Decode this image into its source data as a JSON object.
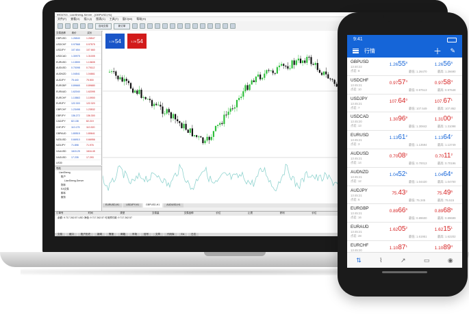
{
  "desktop": {
    "window_title": "9903703 - LianSheng-Server - [GBPUSD,H1]",
    "menu": [
      "文件(F)",
      "查看(V)",
      "插入(I)",
      "图表(C)",
      "工具(T)",
      "窗口(W)",
      "帮助(H)"
    ],
    "toolbar": {
      "algo_label": "自动交易",
      "new_order_label": "新订单"
    },
    "market_watch": {
      "title": "市场报价: 13:48:30",
      "headers": [
        "交易品种",
        "卖价",
        "买价"
      ],
      "rows": [
        {
          "sym": "GBPUSD",
          "bid": "1.26540",
          "ask": "1.26547"
        },
        {
          "sym": "USDCHF",
          "bid": "0.97568",
          "ask": "0.97575"
        },
        {
          "sym": "USDJPY",
          "bid": "107.654",
          "ask": "107.660"
        },
        {
          "sym": "USDCAD",
          "bid": "1.30975",
          "ask": "1.31005"
        },
        {
          "sym": "EURUSD",
          "bid": "1.13599",
          "ask": "1.13605"
        },
        {
          "sym": "AUDUSD",
          "bid": "0.70098",
          "ask": "0.70112"
        },
        {
          "sym": "AUDNZD",
          "bid": "1.04541",
          "ask": "1.04661"
        },
        {
          "sym": "AUDJPY",
          "bid": "75.440",
          "ask": "75.500"
        },
        {
          "sym": "EURGBP",
          "bid": "0.89665",
          "ask": "0.89680"
        },
        {
          "sym": "EURAUD",
          "bid": "1.62040",
          "ask": "1.62095"
        },
        {
          "sym": "EURCHF",
          "bid": "1.10863",
          "ask": "1.10900"
        },
        {
          "sym": "EURJPY",
          "bid": "122.303",
          "ask": "122.320"
        },
        {
          "sym": "GBPCHF",
          "bid": "1.23498",
          "ask": "1.23532"
        },
        {
          "sym": "GBPJPY",
          "bid": "136.272",
          "ask": "136.300"
        },
        {
          "sym": "CADJPY",
          "bid": "82.138",
          "ask": "82.219"
        },
        {
          "sym": "CHFJPY",
          "bid": "110.175",
          "ask": "110.320"
        },
        {
          "sym": "GBPAUD",
          "bid": "1.80515",
          "ask": "1.80641"
        },
        {
          "sym": "NZDUSD",
          "bid": "0.66910",
          "ask": "0.66956"
        },
        {
          "sym": "NZDJPY",
          "bid": "71.898",
          "ask": "71.976"
        },
        {
          "sym": "XAUUSD",
          "bid": "1615.25",
          "ask": "1616.45"
        },
        {
          "sym": "XAGUSD",
          "bid": "17.235",
          "ask": "17.293"
        },
        {
          "sym": "US30",
          "bid": "",
          "ask": ""
        },
        {
          "sym": "UK100",
          "bid": "",
          "ask": ""
        },
        {
          "sym": "NK225",
          "bid": "",
          "ask": ""
        },
        {
          "sym": "FRA40",
          "bid": "",
          "ask": ""
        }
      ]
    },
    "navigator": {
      "title": "导航",
      "items": [
        "LianSheng",
        "账户",
        "LianSheng-Server",
        "指标",
        "EA交易",
        "脚本",
        "服务"
      ]
    },
    "trade_panel": {
      "sell_price": "54",
      "buy_price": "54",
      "sell_prefix": "1.26",
      "buy_prefix": "1.26"
    },
    "chart_tabs": [
      "EURUSD,H1",
      "USDJPY,H1",
      "GBPUSD,H1",
      "AUDUSD,H1"
    ],
    "terminal": {
      "headers": [
        "订单号",
        "时间",
        "类型",
        "交易量",
        "交易品种",
        "价位",
        "止损",
        "获利",
        "价位",
        "手续费",
        "库存费",
        "获利"
      ],
      "balance_line": "余额: 9 717 262.57 USD   净值: 9 717 262.57   可用预付款: 9 717 262.57",
      "tabs": [
        "交易",
        "敞口",
        "账户历史",
        "新闻",
        "警报",
        "邮箱",
        "市场",
        "信号",
        "文章",
        "代码库",
        "EA",
        "日志"
      ]
    },
    "chart_data": {
      "type": "candlestick",
      "title": "GBPUSD,H1",
      "colors": {
        "up": "#2dbf3a",
        "down": "#111111",
        "oscillator": "#8fd3cf"
      }
    }
  },
  "phone": {
    "time": "9:41",
    "title": "行情",
    "quotes": [
      {
        "sym": "GBPUSD",
        "time": "13:40:22",
        "spread": "点差: 8",
        "bid_a": "1.26",
        "bid_b": "55",
        "bid_c": "8",
        "ask_a": "1.26",
        "ask_b": "56",
        "ask_c": "6",
        "low": "最低: 1.26470",
        "high": "最高: 1.26690",
        "bid_dir": "up",
        "ask_dir": "up"
      },
      {
        "sym": "USDCHF",
        "time": "13:45:21",
        "spread": "点差: 10",
        "bid_a": "0.97",
        "bid_b": "57",
        "bid_c": "4",
        "ask_a": "0.97",
        "ask_b": "58",
        "ask_c": "4",
        "low": "最低: 0.97513",
        "high": "最高: 0.97648",
        "bid_dir": "down",
        "ask_dir": "down"
      },
      {
        "sym": "USDJPY",
        "time": "13:45:21",
        "spread": "点差: 7",
        "bid_a": "107.",
        "bid_b": "64",
        "bid_c": "0",
        "ask_a": "107.",
        "ask_b": "67",
        "ask_c": "1",
        "low": "最低: 107.549",
        "high": "最高: 107.862",
        "bid_dir": "down",
        "ask_dir": "down"
      },
      {
        "sym": "USDCAD",
        "time": "13:45:20",
        "spread": "点差: 13",
        "bid_a": "1.30",
        "bid_b": "96",
        "bid_c": "9",
        "ask_a": "1.31",
        "ask_b": "00",
        "ask_c": "4",
        "low": "最低: 1.30842",
        "high": "最高: 1.31098",
        "bid_dir": "down",
        "ask_dir": "down"
      },
      {
        "sym": "EURUSD",
        "time": "13:45:21",
        "spread": "点差: 3",
        "bid_a": "1.13",
        "bid_b": "61",
        "bid_c": "2",
        "ask_a": "1.13",
        "ask_b": "64",
        "ask_c": "7",
        "low": "最低: 1.13594",
        "high": "最高: 1.13749",
        "bid_dir": "up",
        "ask_dir": "up"
      },
      {
        "sym": "AUDUSD",
        "time": "13:45:21",
        "spread": "点差: 14",
        "bid_a": "0.70",
        "bid_b": "08",
        "bid_c": "2",
        "ask_a": "0.70",
        "ask_b": "11",
        "ask_c": "2",
        "low": "最低: 0.70013",
        "high": "最高: 0.70196",
        "bid_dir": "down",
        "ask_dir": "down"
      },
      {
        "sym": "AUDNZD",
        "time": "13:45:21",
        "spread": "点差: 12",
        "bid_a": "1.04",
        "bid_b": "52",
        "bid_c": "1",
        "ask_a": "1.04",
        "ask_b": "64",
        "ask_c": "8",
        "low": "最低: 1.04420",
        "high": "最高: 1.04700",
        "bid_dir": "up",
        "ask_dir": "up"
      },
      {
        "sym": "AUDJPY",
        "time": "13:45:21",
        "spread": "点差: 6",
        "bid_a": "75.",
        "bid_b": "43",
        "bid_c": "2",
        "ask_a": "75.",
        "ask_b": "49",
        "ask_c": "5",
        "low": "最低: 75.345",
        "high": "最高: 75.515",
        "bid_dir": "down",
        "ask_dir": "down"
      },
      {
        "sym": "EURGBP",
        "time": "13:45:21",
        "spread": "点差: 16",
        "bid_a": "0.89",
        "bid_b": "66",
        "bid_c": "6",
        "ask_a": "0.89",
        "ask_b": "68",
        "ask_c": "5",
        "low": "最低: 0.89600",
        "high": "最高: 0.89699",
        "bid_dir": "down",
        "ask_dir": "down"
      },
      {
        "sym": "EURAUD",
        "time": "13:45:21",
        "spread": "点差: 28",
        "bid_a": "1.62",
        "bid_b": "05",
        "bid_c": "2",
        "ask_a": "1.62",
        "ask_b": "15",
        "ask_c": "1",
        "low": "最低: 1.61951",
        "high": "最高: 1.62202",
        "bid_dir": "down",
        "ask_dir": "down"
      },
      {
        "sym": "EURCHF",
        "time": "13:45:20",
        "spread": "点差: 11",
        "bid_a": "1.10",
        "bid_b": "87",
        "bid_c": "1",
        "ask_a": "1.10",
        "ask_b": "89",
        "ask_c": "4",
        "low": "最低: 1.10800",
        "high": "最高: 1.10976",
        "bid_dir": "down",
        "ask_dir": "down"
      }
    ],
    "tabs": [
      "quotes-icon",
      "chart-icon",
      "trade-icon",
      "history-icon",
      "chat-icon"
    ],
    "colors": {
      "accent": "#1565d8",
      "up": "#1565d8",
      "down": "#d62222"
    }
  }
}
